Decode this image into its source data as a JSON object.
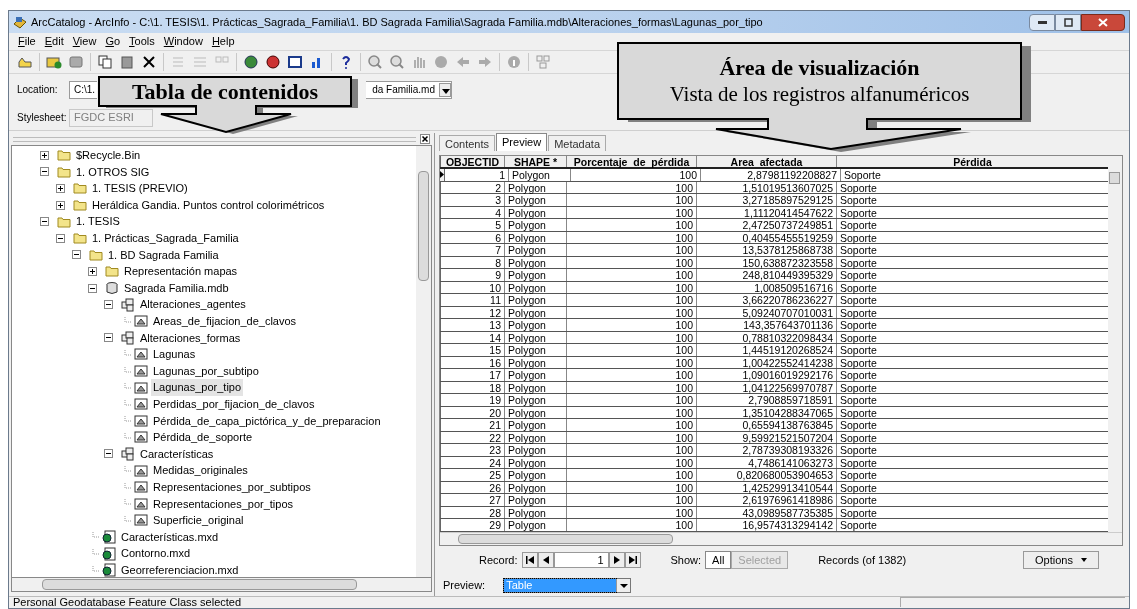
{
  "window": {
    "title": "ArcCatalog - ArcInfo - C:\\1. TESIS\\1. Prácticas_Sagrada_Familia\\1. BD Sagrada Familia\\Sagrada Familia.mdb\\Alteraciones_formas\\Lagunas_por_tipo"
  },
  "menu": [
    "File",
    "Edit",
    "View",
    "Go",
    "Tools",
    "Window",
    "Help"
  ],
  "location": {
    "label": "Location:",
    "value_start": "C:\\1.",
    "value_end": "da Familia.md"
  },
  "stylesheet": {
    "label": "Stylesheet:",
    "value": "FGDC ESRI",
    "disabled": true
  },
  "callouts": [
    {
      "title": "Tabla de contenidos"
    },
    {
      "title": "Área de visualización",
      "subtitle": "Vista de los registros alfanuméricos"
    }
  ],
  "tree": {
    "items": [
      {
        "label": "$Recycle.Bin",
        "kind": "folder",
        "expanded": false,
        "selected": false
      },
      {
        "label": "1. OTROS SIG",
        "kind": "folder",
        "expanded": true,
        "selected": false,
        "children": [
          {
            "label": "1. TESIS (PREVIO)",
            "kind": "folder",
            "expanded": false,
            "selected": false
          },
          {
            "label": "Heráldica Gandia. Puntos control colorimétricos",
            "kind": "folder",
            "expanded": false,
            "selected": false
          }
        ]
      },
      {
        "label": "1. TESIS",
        "kind": "folder",
        "expanded": true,
        "selected": false,
        "children": [
          {
            "label": "1. Prácticas_Sagrada_Familia",
            "kind": "folder",
            "expanded": true,
            "selected": false,
            "children": [
              {
                "label": "1. BD Sagrada Familia",
                "kind": "folder",
                "expanded": true,
                "selected": false,
                "children": [
                  {
                    "label": "Representación mapas",
                    "kind": "folder",
                    "expanded": false,
                    "selected": false
                  },
                  {
                    "label": "Sagrada Familia.mdb",
                    "kind": "database",
                    "expanded": true,
                    "selected": false,
                    "children": [
                      {
                        "label": "Alteraciones_agentes",
                        "kind": "dataset",
                        "expanded": true,
                        "selected": false,
                        "children": [
                          {
                            "label": "Areas_de_fijacion_de_clavos",
                            "kind": "featureclass",
                            "selected": false
                          }
                        ]
                      },
                      {
                        "label": "Alteraciones_formas",
                        "kind": "dataset",
                        "expanded": true,
                        "selected": false,
                        "children": [
                          {
                            "label": "Lagunas",
                            "kind": "featureclass",
                            "selected": false
                          },
                          {
                            "label": "Lagunas_por_subtipo",
                            "kind": "featureclass",
                            "selected": false
                          },
                          {
                            "label": "Lagunas_por_tipo",
                            "kind": "featureclass",
                            "selected": true
                          },
                          {
                            "label": "Perdidas_por_fijacion_de_clavos",
                            "kind": "featureclass",
                            "selected": false
                          },
                          {
                            "label": "Pérdida_de_capa_pictórica_y_de_preparacion",
                            "kind": "featureclass",
                            "selected": false
                          },
                          {
                            "label": "Pérdida_de_soporte",
                            "kind": "featureclass",
                            "selected": false
                          }
                        ]
                      },
                      {
                        "label": "Características",
                        "kind": "dataset",
                        "expanded": true,
                        "selected": false,
                        "children": [
                          {
                            "label": "Medidas_originales",
                            "kind": "featureclass",
                            "selected": false
                          },
                          {
                            "label": "Representaciones_por_subtipos",
                            "kind": "featureclass",
                            "selected": false
                          },
                          {
                            "label": "Representaciones_por_tipos",
                            "kind": "featureclass",
                            "selected": false
                          },
                          {
                            "label": "Superficie_original",
                            "kind": "featureclass",
                            "selected": false
                          }
                        ]
                      }
                    ]
                  },
                  {
                    "label": "Características.mxd",
                    "kind": "map",
                    "selected": false
                  },
                  {
                    "label": "Contorno.mxd",
                    "kind": "map",
                    "selected": false
                  },
                  {
                    "label": "Georreferenciacion.mxd",
                    "kind": "map",
                    "selected": false
                  }
                ]
              }
            ]
          }
        ]
      }
    ]
  },
  "tabs": [
    {
      "label": "Contents",
      "selected": false
    },
    {
      "label": "Preview",
      "selected": true
    },
    {
      "label": "Metadata",
      "selected": false
    }
  ],
  "table": {
    "columns": [
      {
        "label": "OBJECTID"
      },
      {
        "label": "SHAPE *"
      },
      {
        "label": "Porcentaje  de  pérdida"
      },
      {
        "label": "Area  afectada"
      },
      {
        "label": "Pérdida"
      }
    ],
    "rows": [
      {
        "current": true,
        "cells": [
          "1",
          "Polygon",
          "100",
          "2,87981192208827",
          "Soporte"
        ]
      },
      {
        "current": false,
        "cells": [
          "2",
          "Polygon",
          "100",
          "1,51019513607025",
          "Soporte"
        ]
      },
      {
        "current": false,
        "cells": [
          "3",
          "Polygon",
          "100",
          "3,27185897529125",
          "Soporte"
        ]
      },
      {
        "current": false,
        "cells": [
          "4",
          "Polygon",
          "100",
          "1,11120414547622",
          "Soporte"
        ]
      },
      {
        "current": false,
        "cells": [
          "5",
          "Polygon",
          "100",
          "2,47250737249851",
          "Soporte"
        ]
      },
      {
        "current": false,
        "cells": [
          "6",
          "Polygon",
          "100",
          "0,40455455519259",
          "Soporte"
        ]
      },
      {
        "current": false,
        "cells": [
          "7",
          "Polygon",
          "100",
          "13,5378125868738",
          "Soporte"
        ]
      },
      {
        "current": false,
        "cells": [
          "8",
          "Polygon",
          "100",
          "150,638872323558",
          "Soporte"
        ]
      },
      {
        "current": false,
        "cells": [
          "9",
          "Polygon",
          "100",
          "248,810449395329",
          "Soporte"
        ]
      },
      {
        "current": false,
        "cells": [
          "10",
          "Polygon",
          "100",
          "1,008509516716",
          "Soporte"
        ]
      },
      {
        "current": false,
        "cells": [
          "11",
          "Polygon",
          "100",
          "3,66220786236227",
          "Soporte"
        ]
      },
      {
        "current": false,
        "cells": [
          "12",
          "Polygon",
          "100",
          "5,09240707010031",
          "Soporte"
        ]
      },
      {
        "current": false,
        "cells": [
          "13",
          "Polygon",
          "100",
          "143,357643701136",
          "Soporte"
        ]
      },
      {
        "current": false,
        "cells": [
          "14",
          "Polygon",
          "100",
          "0,78810322098434",
          "Soporte"
        ]
      },
      {
        "current": false,
        "cells": [
          "15",
          "Polygon",
          "100",
          "1,44519120268524",
          "Soporte"
        ]
      },
      {
        "current": false,
        "cells": [
          "16",
          "Polygon",
          "100",
          "1,00422552414238",
          "Soporte"
        ]
      },
      {
        "current": false,
        "cells": [
          "17",
          "Polygon",
          "100",
          "1,09016019292176",
          "Soporte"
        ]
      },
      {
        "current": false,
        "cells": [
          "18",
          "Polygon",
          "100",
          "1,04122569970787",
          "Soporte"
        ]
      },
      {
        "current": false,
        "cells": [
          "19",
          "Polygon",
          "100",
          "2,7908859718591",
          "Soporte"
        ]
      },
      {
        "current": false,
        "cells": [
          "20",
          "Polygon",
          "100",
          "1,35104288347065",
          "Soporte"
        ]
      },
      {
        "current": false,
        "cells": [
          "21",
          "Polygon",
          "100",
          "0,65594138763845",
          "Soporte"
        ]
      },
      {
        "current": false,
        "cells": [
          "22",
          "Polygon",
          "100",
          "9,59921521507204",
          "Soporte"
        ]
      },
      {
        "current": false,
        "cells": [
          "23",
          "Polygon",
          "100",
          "2,78739308193326",
          "Soporte"
        ]
      },
      {
        "current": false,
        "cells": [
          "24",
          "Polygon",
          "100",
          "4,7486141063273",
          "Soporte"
        ]
      },
      {
        "current": false,
        "cells": [
          "25",
          "Polygon",
          "100",
          "0,820680053904653",
          "Soporte"
        ]
      },
      {
        "current": false,
        "cells": [
          "26",
          "Polygon",
          "100",
          "1,42529913410544",
          "Soporte"
        ]
      },
      {
        "current": false,
        "cells": [
          "27",
          "Polygon",
          "100",
          "2,61976961418986",
          "Soporte"
        ]
      },
      {
        "current": false,
        "cells": [
          "28",
          "Polygon",
          "100",
          "43,0989587735385",
          "Soporte"
        ]
      },
      {
        "current": false,
        "cells": [
          "29",
          "Polygon",
          "100",
          "16,9574313294142",
          "Soporte"
        ]
      }
    ]
  },
  "record_bar": {
    "label": "Record:",
    "value": "1",
    "show_label": "Show:",
    "show_options": [
      {
        "label": "All",
        "selected": true,
        "disabled": false
      },
      {
        "label": "Selected",
        "selected": false,
        "disabled": true
      }
    ],
    "count": "Records (of 1382)",
    "options": "Options"
  },
  "preview": {
    "label": "Preview:",
    "value": "Table",
    "focused": true
  },
  "status_bar": "Personal Geodatabase Feature Class selected"
}
